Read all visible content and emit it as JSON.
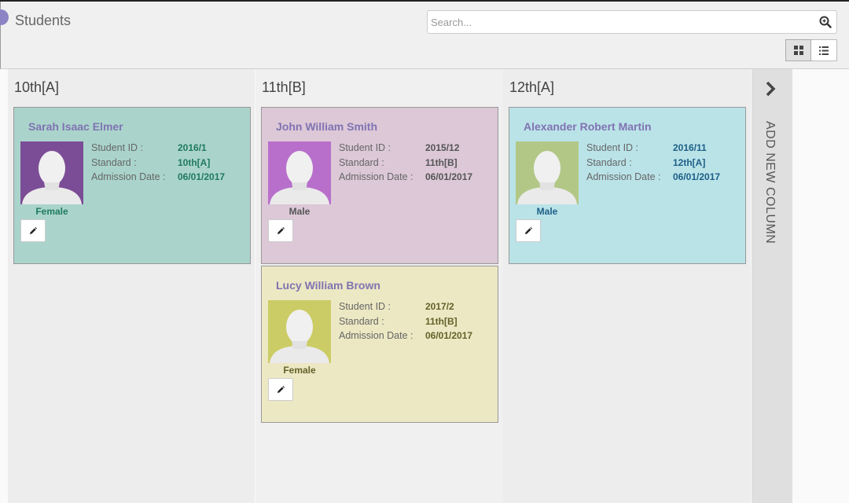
{
  "header": {
    "title": "Students",
    "search_placeholder": "Search..."
  },
  "icons": {
    "search": "search-icon",
    "kanban_view": "grid-icon",
    "list_view": "list-icon",
    "edit": "pencil-icon",
    "add_column": "chevron-right-icon"
  },
  "columns": [
    {
      "title": "10th[A]",
      "cards": [
        {
          "name": "Sarah Isaac Elmer",
          "gender": "Female",
          "student_id": "2016/1",
          "standard": "10th[A]",
          "admission_date": "06/01/2017",
          "color": "#aad4cb",
          "avatar_color": "#7b4d96",
          "accent": "#1f7a5e"
        }
      ]
    },
    {
      "title": "11th[B]",
      "cards": [
        {
          "name": "John William Smith",
          "gender": "Male",
          "student_id": "2015/12",
          "standard": "11th[B]",
          "admission_date": "06/01/2017",
          "color": "#dcc8d7",
          "avatar_color": "#b86fcb",
          "accent": "#555555"
        },
        {
          "name": "Lucy William Brown",
          "gender": "Female",
          "student_id": "2017/2",
          "standard": "11th[B]",
          "admission_date": "06/01/2017",
          "color": "#ece8c3",
          "avatar_color": "#cccc66",
          "accent": "#66602a"
        }
      ]
    },
    {
      "title": "12th[A]",
      "cards": [
        {
          "name": "Alexander Robert Martin",
          "gender": "Male",
          "student_id": "2016/11",
          "standard": "12th[A]",
          "admission_date": "06/01/2017",
          "color": "#bae3e8",
          "avatar_color": "#b2c786",
          "accent": "#1d5f86"
        }
      ]
    }
  ],
  "labels": {
    "student_id": "Student ID :",
    "standard": "Standard :",
    "admission_date": "Admission Date :"
  },
  "add_column": {
    "label": "ADD NEW COLUMN"
  }
}
